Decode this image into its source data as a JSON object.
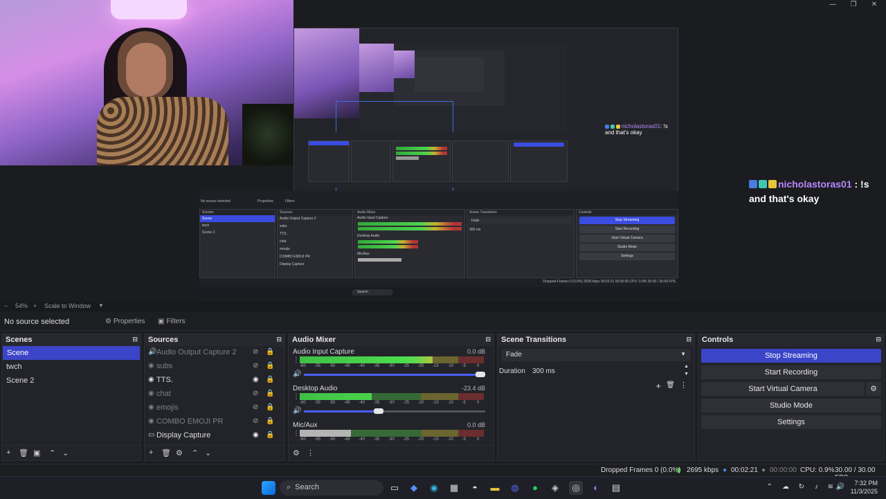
{
  "window": {
    "minimize": "—",
    "maximize": "❐",
    "close": "✕"
  },
  "chat_overlay": {
    "username": "nicholastoras01",
    "message_line1": ": !s",
    "message_line2": "and that's okay"
  },
  "zoom": {
    "minus": "−",
    "value": "54%",
    "plus": "+",
    "mode": "Scale to Window",
    "dropdown": "▼"
  },
  "source_toolbar": {
    "label": "No source selected",
    "properties": "Properties",
    "filters": "Filters"
  },
  "scenes": {
    "title": "Scenes",
    "items": [
      "Scene",
      "twch",
      "Scene 2"
    ],
    "selected": 0
  },
  "sources": {
    "title": "Sources",
    "items": [
      {
        "name": "Audio Output Capture 2",
        "icon": "speaker-icon",
        "visible": false
      },
      {
        "name": "subs",
        "icon": "globe-icon",
        "visible": false
      },
      {
        "name": "TTS.",
        "icon": "globe-icon",
        "visible": true
      },
      {
        "name": "chat",
        "icon": "globe-icon",
        "visible": false
      },
      {
        "name": "emojis",
        "icon": "globe-icon",
        "visible": false
      },
      {
        "name": "COMBO EMOJI PR",
        "icon": "globe-icon",
        "visible": false
      },
      {
        "name": "Display Capture",
        "icon": "monitor-icon",
        "visible": true
      }
    ]
  },
  "mixer": {
    "title": "Audio Mixer",
    "scale": [
      "-60",
      "-55",
      "-50",
      "-45",
      "-40",
      "-35",
      "-30",
      "-25",
      "-20",
      "-15",
      "-10",
      "-5",
      "0"
    ],
    "channels": [
      {
        "name": "Audio Input Capture",
        "db": "0.0 dB",
        "level": 0.72,
        "volume": 1.0,
        "muted": false
      },
      {
        "name": "Desktop Audio",
        "db": "-23.4 dB",
        "level": 0.39,
        "volume": 0.44,
        "muted": false
      },
      {
        "name": "Mic/Aux",
        "db": "0.0 dB",
        "level": 0.28,
        "volume": 1.0,
        "muted": true
      }
    ]
  },
  "transitions": {
    "title": "Scene Transitions",
    "selected": "Fade",
    "duration_label": "Duration",
    "duration_value": "300 ms"
  },
  "controls": {
    "title": "Controls",
    "buttons": [
      "Stop Streaming",
      "Start Recording",
      "Start Virtual Camera",
      "Studio Mode",
      "Settings"
    ]
  },
  "status": {
    "dropped": "Dropped Frames 0 (0.0%)",
    "bitrate": "2695 kbps",
    "stream_time": "00:02:21",
    "rec_time": "00:00:00",
    "cpu": "CPU: 0.9%",
    "fps": "30.00 / 30.00 FPS"
  },
  "taskbar": {
    "search": "Search",
    "time": "7:32 PM",
    "date": "11/3/2025"
  },
  "mini_capture": {
    "scenes": [
      "Scene",
      "twch",
      "Scene 2"
    ],
    "sources": [
      "Audio Output Capture 2",
      "subs",
      "TTS.",
      "chat",
      "emojis",
      "COMBO EMOJI PR",
      "Display Capture"
    ],
    "controls": [
      "Stop Streaming",
      "Start Recording",
      "Start Virtual Camera",
      "Studio Mode",
      "Settings"
    ],
    "fade": "Fade",
    "duration": "300 ms",
    "no_source": "No source selected",
    "properties": "Properties",
    "filters": "Filters",
    "mixer_ch": [
      "Audio Input Capture",
      "Desktop Audio",
      "Mic/Aux"
    ],
    "search": "Search",
    "status": "Dropped Frames 0 (0.0%)  2695 kbps  00:02:21  00:00:00  CPU: 0.9%  30.00 / 30.00 FPS",
    "headers": {
      "scenes": "Scenes",
      "sources": "Sources",
      "mixer": "Audio Mixer",
      "transitions": "Scene Transitions",
      "controls": "Controls"
    }
  },
  "colors": {
    "accent": "#3b45c8",
    "panel": "#23242a",
    "background": "#1d1e22",
    "chat_name": "#b887ff"
  }
}
